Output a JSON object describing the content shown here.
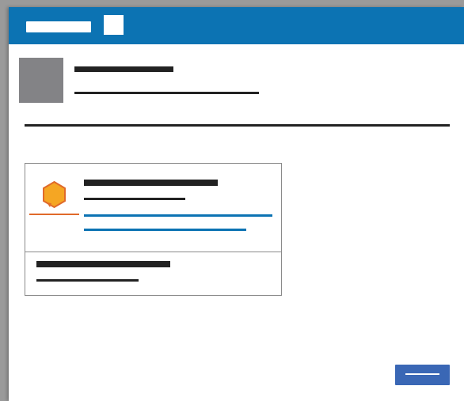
{
  "titlebar": {
    "title_placeholder": "",
    "icon": "app-icon"
  },
  "header": {
    "avatar_icon": "avatar-placeholder",
    "title": "",
    "subtitle": ""
  },
  "card": {
    "badge_icon": "hexagon-badge-icon",
    "badge_color": "#f5a623",
    "badge_accent": "#e06a2a",
    "link_color": "#0c73b3",
    "items": [
      {
        "title": "",
        "subtitle": "",
        "links": [
          "",
          ""
        ]
      },
      {
        "title": "",
        "subtitle": ""
      }
    ]
  },
  "footer": {
    "action_label": ""
  },
  "colors": {
    "titlebar": "#0c73b3",
    "button": "#3a67b5",
    "avatar": "#838386"
  }
}
